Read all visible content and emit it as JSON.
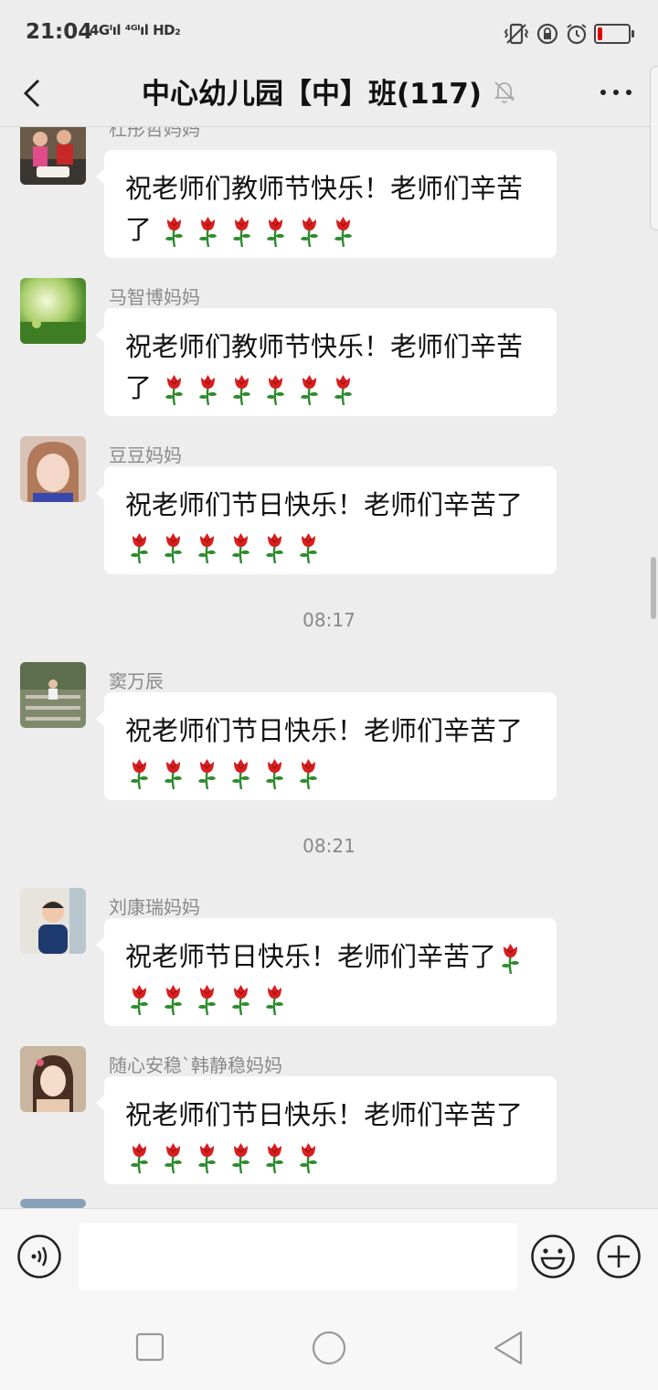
{
  "status_bar": {
    "time": "21:04",
    "network_text": "4Gᴵıl ⁴ᴳᴵıl HD₂",
    "icons": [
      "vibrate-icon",
      "lock-rotation-icon",
      "alarm-icon",
      "battery-low-icon"
    ],
    "battery_level": 0.15,
    "battery_color": "#e00000"
  },
  "header": {
    "title": "中心幼儿园【中】班(117)",
    "mute_icon": "bell-muted-icon",
    "back_icon": "chevron-left-icon",
    "more_icon": "more-dots-icon"
  },
  "messages": [
    {
      "sender": "杜彤哲妈妈",
      "line1": "祝老师们教师节快乐！老师们辛苦",
      "line2": "了",
      "roses_line1": 0,
      "roses_line2": 6
    },
    {
      "sender": "马智博妈妈",
      "line1": "祝老师们教师节快乐！老师们辛苦",
      "line2": "了",
      "roses_line1": 0,
      "roses_line2": 6
    },
    {
      "sender": "豆豆妈妈",
      "line1": "祝老师们节日快乐！老师们辛苦了",
      "line2": "",
      "roses_line1": 0,
      "roses_line2": 6
    },
    {
      "timestamp": "08:17"
    },
    {
      "sender": "窦万辰",
      "line1": "祝老师们节日快乐！老师们辛苦了",
      "line2": "",
      "roses_line1": 0,
      "roses_line2": 6
    },
    {
      "timestamp": "08:21"
    },
    {
      "sender": "刘康瑞妈妈",
      "line1": "祝老师节日快乐！老师们辛苦了",
      "line2": "",
      "roses_line1": 1,
      "roses_line2": 5
    },
    {
      "sender": "随心安稳`韩静稳妈妈",
      "line1": "祝老师们节日快乐！老师们辛苦了",
      "line2": "",
      "roses_line1": 0,
      "roses_line2": 6
    }
  ],
  "input_bar": {
    "voice_icon": "voice-input-icon",
    "emoji_icon": "emoji-icon",
    "plus_icon": "plus-icon",
    "input_value": ""
  },
  "nav_bar": {
    "icons": [
      "recent-apps-icon",
      "home-icon",
      "back-triangle-icon"
    ]
  },
  "colors": {
    "background": "#ededed",
    "bubble": "#ffffff",
    "sender_text": "#8a8a8a",
    "rose": "#d81e1e",
    "stem": "#2e8b2e"
  }
}
